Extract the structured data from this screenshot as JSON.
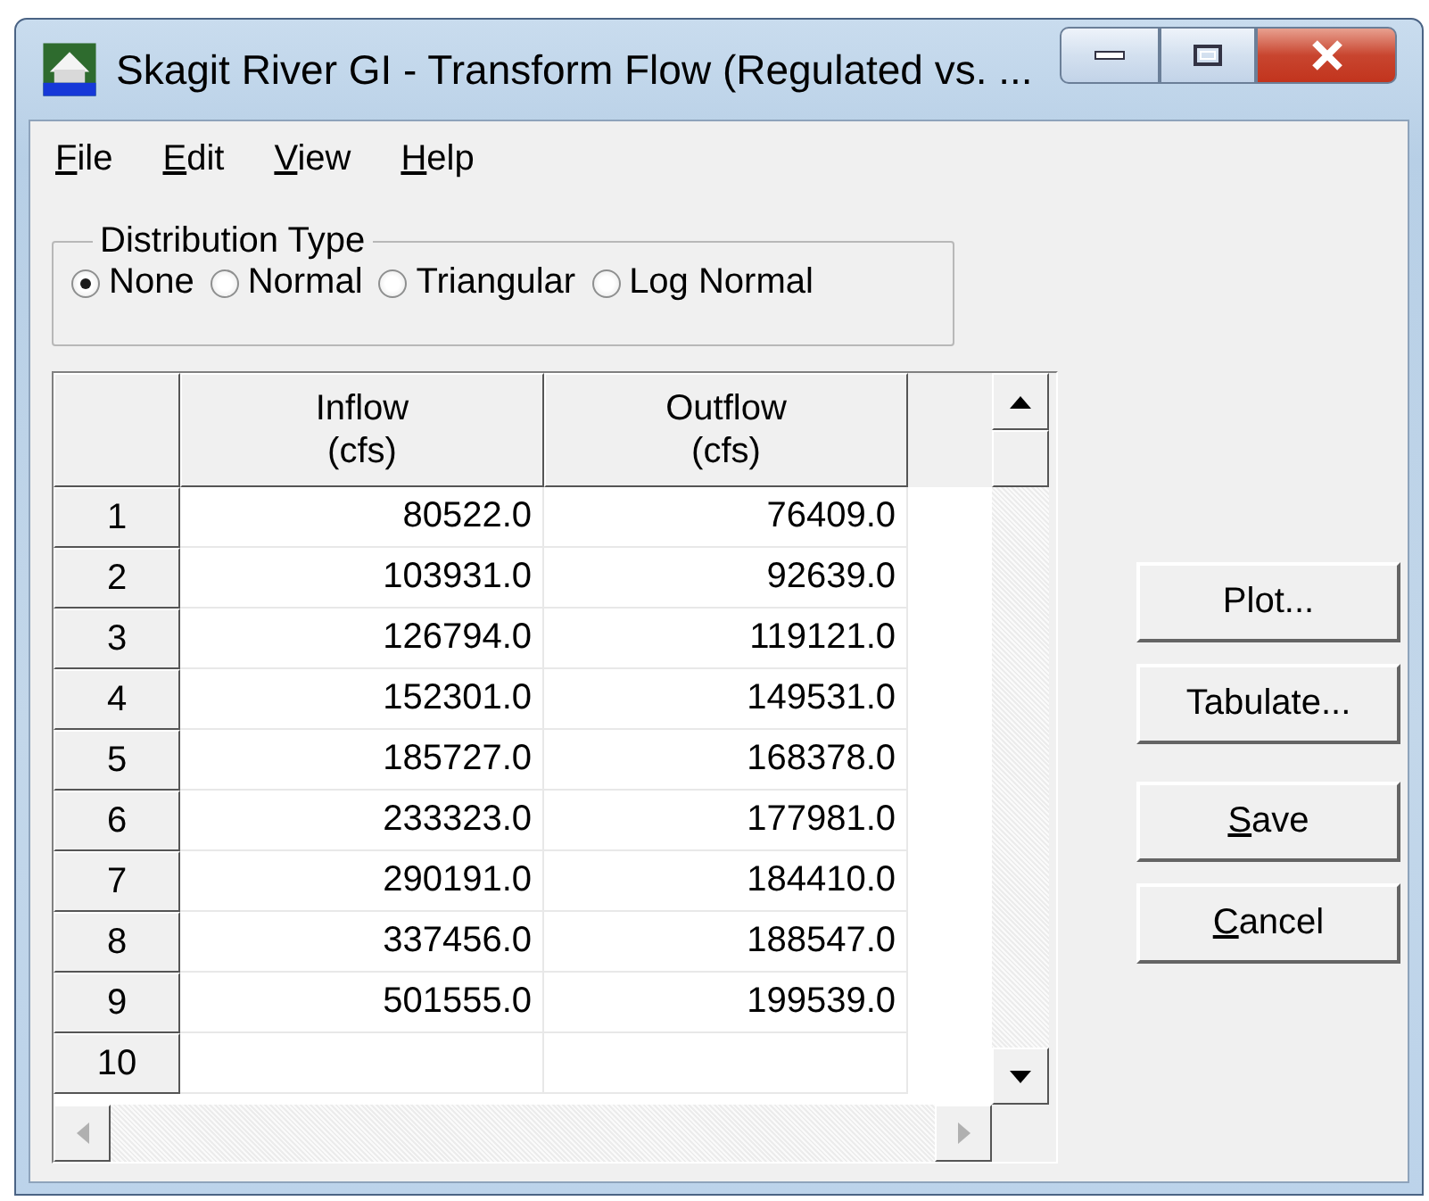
{
  "window": {
    "title": "Skagit River GI - Transform Flow (Regulated vs. ..."
  },
  "menu": [
    {
      "label": "File",
      "mnemonic": true
    },
    {
      "label": "Edit",
      "mnemonic": true
    },
    {
      "label": "View",
      "mnemonic": true
    },
    {
      "label": "Help",
      "mnemonic": true
    }
  ],
  "distribution_type": {
    "label": "Distribution Type",
    "options": [
      {
        "label": "None",
        "selected": true
      },
      {
        "label": "Normal",
        "selected": false
      },
      {
        "label": "Triangular",
        "selected": false
      },
      {
        "label": "Log Normal",
        "selected": false
      }
    ]
  },
  "table": {
    "columns": [
      {
        "name": "Inflow",
        "unit": "(cfs)"
      },
      {
        "name": "Outflow",
        "unit": "(cfs)"
      }
    ],
    "rows": [
      {
        "number": "1",
        "cells": [
          "80522.0",
          "76409.0"
        ]
      },
      {
        "number": "2",
        "cells": [
          "103931.0",
          "92639.0"
        ]
      },
      {
        "number": "3",
        "cells": [
          "126794.0",
          "119121.0"
        ]
      },
      {
        "number": "4",
        "cells": [
          "152301.0",
          "149531.0"
        ]
      },
      {
        "number": "5",
        "cells": [
          "185727.0",
          "168378.0"
        ]
      },
      {
        "number": "6",
        "cells": [
          "233323.0",
          "177981.0"
        ]
      },
      {
        "number": "7",
        "cells": [
          "290191.0",
          "184410.0"
        ]
      },
      {
        "number": "8",
        "cells": [
          "337456.0",
          "188547.0"
        ]
      },
      {
        "number": "9",
        "cells": [
          "501555.0",
          "199539.0"
        ]
      },
      {
        "number": "10",
        "cells": []
      }
    ]
  },
  "buttons": [
    {
      "label": "Plot...",
      "mnemonic": false
    },
    {
      "label": "Tabulate...",
      "mnemonic": false
    },
    {
      "label": "Save",
      "mnemonic": true
    },
    {
      "label": "Cancel",
      "mnemonic": true
    }
  ]
}
